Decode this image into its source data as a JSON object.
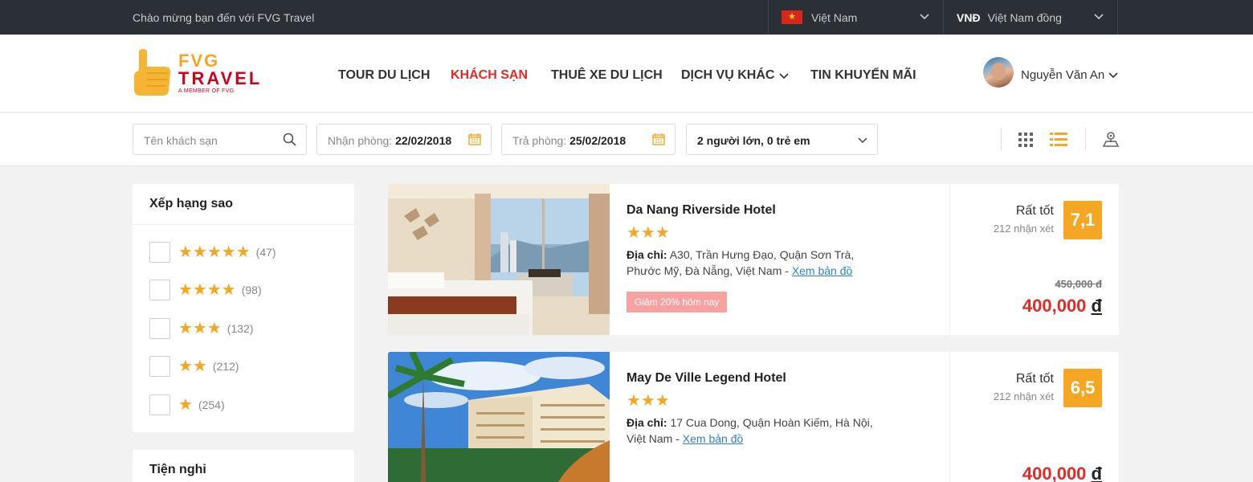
{
  "topbar": {
    "welcome": "Chào mừng bạn đến với FVG Travel",
    "country": "Việt Nam",
    "currency_code": "VNĐ",
    "currency_name": "Việt Nam đồng"
  },
  "logo": {
    "line1": "FVG",
    "line2": "TRAVEL",
    "tagline": "A MEMBER OF FVG"
  },
  "nav": {
    "items": [
      "TOUR DU LỊCH",
      "KHÁCH SẠN",
      "THUÊ XE DU LỊCH",
      "DỊCH VỤ KHÁC",
      "TIN KHUYẾN MÃI"
    ],
    "active": "KHÁCH SẠN"
  },
  "user": {
    "name": "Nguyễn Văn An"
  },
  "search": {
    "hotel_placeholder": "Tên khách sạn",
    "checkin_label": "Nhận phòng:",
    "checkin_value": "22/02/2018",
    "checkout_label": "Trả phòng:",
    "checkout_value": "25/02/2018",
    "guests": "2 người lớn, 0 trẻ em"
  },
  "filters": {
    "star_title": "Xếp hạng sao",
    "star_options": [
      {
        "stars": "★★★★★",
        "count": "(47)"
      },
      {
        "stars": "★★★★",
        "count": "(98)"
      },
      {
        "stars": "★★★",
        "count": "(132)"
      },
      {
        "stars": "★★",
        "count": "(212)"
      },
      {
        "stars": "★",
        "count": "(254)"
      }
    ],
    "amenities_title": "Tiện nghi"
  },
  "hotels": [
    {
      "name": "Da Nang Riverside Hotel",
      "stars": "★★★",
      "address_label": "Địa chỉ:",
      "address": "A30, Trần Hưng Đạo, Quận Sơn Trà, Phước Mỹ, Đà Nẵng, Việt Nam -",
      "map_link": "Xem bản đồ",
      "promo": "Giảm 20% hôm nay",
      "rating_word": "Rất tốt",
      "reviews": "212 nhận xét",
      "score": "7,1",
      "old_price": "450,000 đ",
      "price": "400,000",
      "currency": "đ"
    },
    {
      "name": "May De Ville Legend Hotel",
      "stars": "★★★",
      "address_label": "Địa chỉ:",
      "address": "17 Cua Dong, Quận Hoàn Kiếm, Hà Nội, Việt Nam -",
      "map_link": "Xem bản đồ",
      "rating_word": "Rất tốt",
      "reviews": "212 nhận xét",
      "score": "6,5",
      "price": "400,000",
      "currency": "đ"
    }
  ],
  "colors": {
    "accent": "#f5a623",
    "active_nav": "#e02b27",
    "topbar": "#2b2f36",
    "link": "#2a7fd4"
  }
}
